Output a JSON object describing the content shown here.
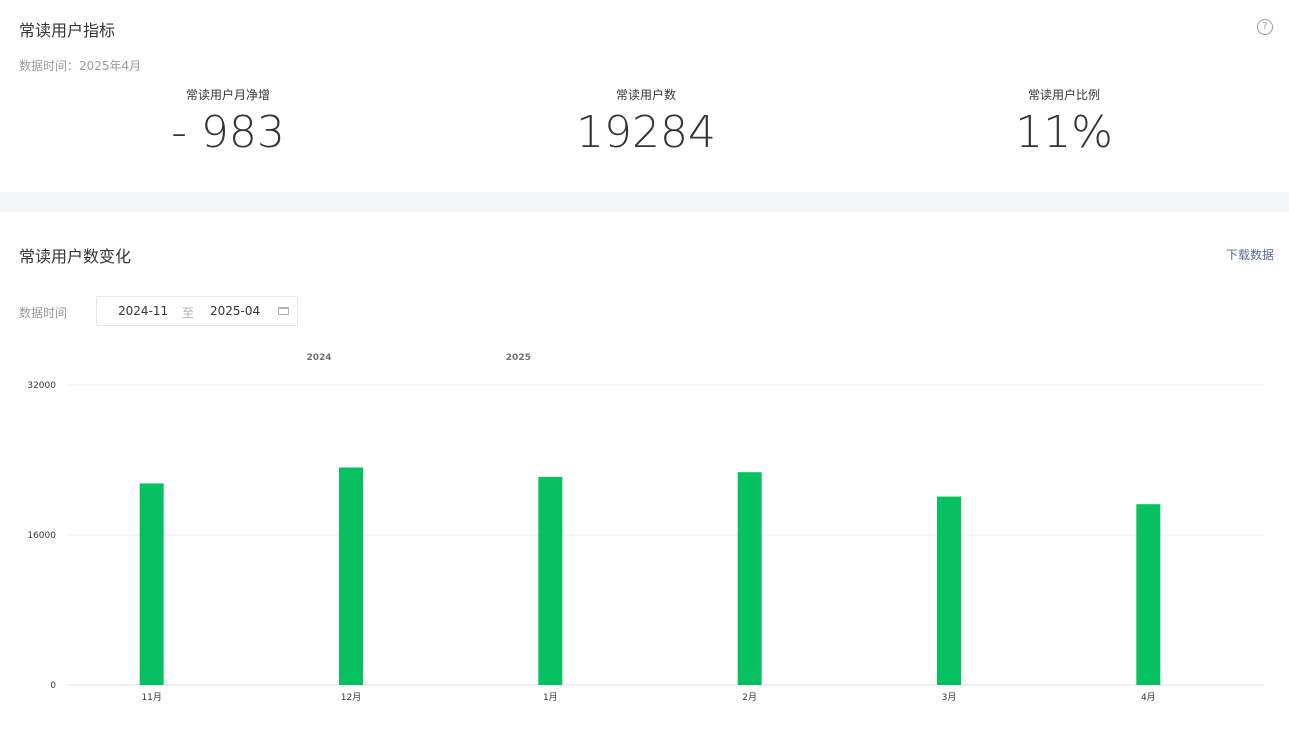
{
  "overview": {
    "title": "常读用户指标",
    "help_glyph": "?",
    "data_time": "数据时间：2025年4月",
    "stats": [
      {
        "label": "常读用户月净增",
        "value": "- 983"
      },
      {
        "label": "常读用户数",
        "value": "19284"
      },
      {
        "label": "常读用户比例",
        "value": "11%"
      }
    ]
  },
  "trend": {
    "title": "常读用户数变化",
    "download_label": "下载数据",
    "range_label": "数据时间",
    "range_start": "2024-11",
    "range_sep": "至",
    "range_end": "2025-04"
  },
  "colors": {
    "bar": "#07c160",
    "grid": "#eeeeee",
    "axis": "#d9dde6"
  },
  "chart_data": {
    "type": "bar",
    "categories": [
      "11月",
      "12月",
      "1月",
      "2月",
      "3月",
      "4月"
    ],
    "values": [
      21500,
      23200,
      22200,
      22700,
      20100,
      19284
    ],
    "year_labels": [
      {
        "label": "2024",
        "at_category": 1
      },
      {
        "label": "2025",
        "at_category": 2
      }
    ],
    "ylim": [
      0,
      32000
    ],
    "yticks": [
      0,
      16000,
      32000
    ],
    "grid": true,
    "title": "",
    "xlabel": "",
    "ylabel": ""
  }
}
